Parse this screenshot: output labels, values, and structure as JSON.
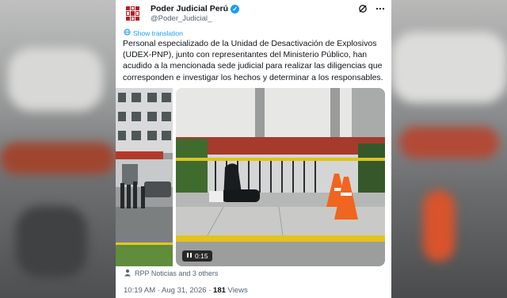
{
  "account": {
    "name": "Poder Judicial Perú",
    "handle": "@Poder_Judicial_"
  },
  "translate_label": "Show translation",
  "tweet_text": "Personal especializado de la Unidad de Desactivación de Explosivos (UDEX-PNP), junto con representantes del Ministerio Público, han acudido a la mencionada sede judicial  para realizar las diligencias que corresponden e investigar los hechos y determinar a los responsables.",
  "video": {
    "duration": "0:15"
  },
  "tagged": "RPP Noticias and 3 others",
  "meta": {
    "time_date": "10:19 AM · Aug 31, 2026 · ",
    "views_count": "181",
    "views_label": " Views"
  },
  "icons": {
    "verified": "verified-badge-icon",
    "grok": "grok-icon",
    "more": "more-icon",
    "translate": "globe-icon",
    "play": "play-icon",
    "person": "person-icon"
  },
  "colors": {
    "accent": "#1d9bf0",
    "brand": "#b41f24",
    "text": "#0f1419",
    "muted": "#536471"
  }
}
